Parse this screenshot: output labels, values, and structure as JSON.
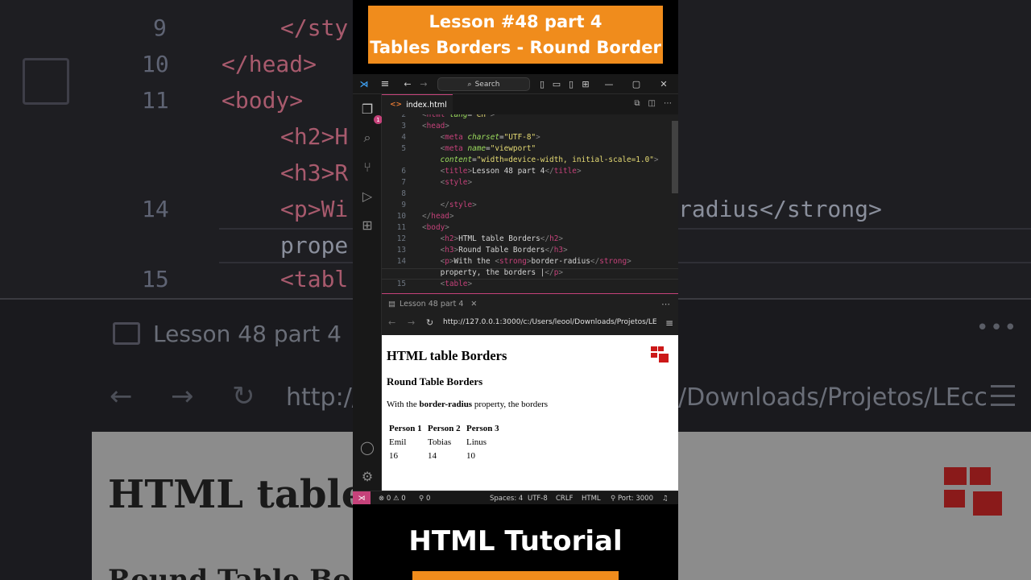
{
  "banner": {
    "line1": "Lesson #48 part 4",
    "line2": "Tables Borders - Round Border"
  },
  "footer": {
    "title": "HTML Tutorial"
  },
  "vscode": {
    "search_label": "Search",
    "explorer_badge": "1",
    "tab": {
      "filename": "index.html",
      "unsaved": true
    },
    "code_lines": [
      {
        "no": "2",
        "segments": [
          {
            "t": "br",
            "v": "<"
          },
          {
            "t": "tag",
            "v": "html"
          },
          {
            "t": "txt",
            "v": " "
          },
          {
            "t": "attr",
            "v": "lang"
          },
          {
            "t": "txt",
            "v": "="
          },
          {
            "t": "str",
            "v": "\"en\""
          },
          {
            "t": "br",
            "v": ">"
          }
        ]
      },
      {
        "no": "3",
        "segments": [
          {
            "t": "br",
            "v": "<"
          },
          {
            "t": "tag",
            "v": "head"
          },
          {
            "t": "br",
            "v": ">"
          }
        ]
      },
      {
        "no": "4",
        "segments": [
          {
            "t": "txt",
            "v": "    "
          },
          {
            "t": "br",
            "v": "<"
          },
          {
            "t": "tag",
            "v": "meta"
          },
          {
            "t": "txt",
            "v": " "
          },
          {
            "t": "attr",
            "v": "charset"
          },
          {
            "t": "txt",
            "v": "="
          },
          {
            "t": "str",
            "v": "\"UTF-8\""
          },
          {
            "t": "br",
            "v": ">"
          }
        ]
      },
      {
        "no": "5",
        "segments": [
          {
            "t": "txt",
            "v": "    "
          },
          {
            "t": "br",
            "v": "<"
          },
          {
            "t": "tag",
            "v": "meta"
          },
          {
            "t": "txt",
            "v": " "
          },
          {
            "t": "attr",
            "v": "name"
          },
          {
            "t": "txt",
            "v": "="
          },
          {
            "t": "str",
            "v": "\"viewport\""
          }
        ]
      },
      {
        "no": "",
        "segments": [
          {
            "t": "txt",
            "v": "    "
          },
          {
            "t": "attr",
            "v": "content"
          },
          {
            "t": "txt",
            "v": "="
          },
          {
            "t": "str",
            "v": "\"width=device-width, initial-scale=1.0\""
          },
          {
            "t": "br",
            "v": ">"
          }
        ]
      },
      {
        "no": "6",
        "segments": [
          {
            "t": "txt",
            "v": "    "
          },
          {
            "t": "br",
            "v": "<"
          },
          {
            "t": "tag",
            "v": "title"
          },
          {
            "t": "br",
            "v": ">"
          },
          {
            "t": "txt",
            "v": "Lesson 48 part 4"
          },
          {
            "t": "br",
            "v": "</"
          },
          {
            "t": "tag",
            "v": "title"
          },
          {
            "t": "br",
            "v": ">"
          }
        ]
      },
      {
        "no": "7",
        "segments": [
          {
            "t": "txt",
            "v": "    "
          },
          {
            "t": "br",
            "v": "<"
          },
          {
            "t": "tag",
            "v": "style"
          },
          {
            "t": "br",
            "v": ">"
          }
        ]
      },
      {
        "no": "8",
        "segments": []
      },
      {
        "no": "9",
        "segments": [
          {
            "t": "txt",
            "v": "    "
          },
          {
            "t": "br",
            "v": "</"
          },
          {
            "t": "tag",
            "v": "style"
          },
          {
            "t": "br",
            "v": ">"
          }
        ]
      },
      {
        "no": "10",
        "segments": [
          {
            "t": "br",
            "v": "</"
          },
          {
            "t": "tag",
            "v": "head"
          },
          {
            "t": "br",
            "v": ">"
          }
        ]
      },
      {
        "no": "11",
        "segments": [
          {
            "t": "br",
            "v": "<"
          },
          {
            "t": "tag",
            "v": "body"
          },
          {
            "t": "br",
            "v": ">"
          }
        ]
      },
      {
        "no": "12",
        "segments": [
          {
            "t": "txt",
            "v": "    "
          },
          {
            "t": "br",
            "v": "<"
          },
          {
            "t": "tag",
            "v": "h2"
          },
          {
            "t": "br",
            "v": ">"
          },
          {
            "t": "txt",
            "v": "HTML table Borders"
          },
          {
            "t": "br",
            "v": "</"
          },
          {
            "t": "tag",
            "v": "h2"
          },
          {
            "t": "br",
            "v": ">"
          }
        ]
      },
      {
        "no": "13",
        "segments": [
          {
            "t": "txt",
            "v": "    "
          },
          {
            "t": "br",
            "v": "<"
          },
          {
            "t": "tag",
            "v": "h3"
          },
          {
            "t": "br",
            "v": ">"
          },
          {
            "t": "txt",
            "v": "Round Table Borders"
          },
          {
            "t": "br",
            "v": "</"
          },
          {
            "t": "tag",
            "v": "h3"
          },
          {
            "t": "br",
            "v": ">"
          }
        ]
      },
      {
        "no": "14",
        "segments": [
          {
            "t": "txt",
            "v": "    "
          },
          {
            "t": "br",
            "v": "<"
          },
          {
            "t": "tag",
            "v": "p"
          },
          {
            "t": "br",
            "v": ">"
          },
          {
            "t": "txt",
            "v": "With the "
          },
          {
            "t": "br",
            "v": "<"
          },
          {
            "t": "tag",
            "v": "strong"
          },
          {
            "t": "br",
            "v": ">"
          },
          {
            "t": "txt",
            "v": "border-radius"
          },
          {
            "t": "br",
            "v": "</"
          },
          {
            "t": "tag",
            "v": "strong"
          },
          {
            "t": "br",
            "v": ">"
          }
        ]
      },
      {
        "no": "",
        "segments": [
          {
            "t": "txt",
            "v": "    property, the borders |"
          },
          {
            "t": "br",
            "v": "</"
          },
          {
            "t": "tag",
            "v": "p"
          },
          {
            "t": "br",
            "v": ">"
          }
        ]
      },
      {
        "no": "15",
        "segments": [
          {
            "t": "txt",
            "v": "    "
          },
          {
            "t": "br",
            "v": "<"
          },
          {
            "t": "tag",
            "v": "table"
          },
          {
            "t": "br",
            "v": ">"
          }
        ]
      }
    ],
    "panel": {
      "tab_title": "Lesson 48 part 4",
      "url": "http://127.0.0.1:3000/c:/Users/leool/Downloads/Projetos/LEcc"
    },
    "preview": {
      "h2": "HTML table Borders",
      "h3": "Round Table Borders",
      "p_prefix": "With the ",
      "p_strong": "border-radius",
      "p_suffix": " property, the borders",
      "table_headers": [
        "Person 1",
        "Person 2",
        "Person 3"
      ],
      "table_rows": [
        [
          "Emil",
          "Tobias",
          "Linus"
        ],
        [
          "16",
          "14",
          "10"
        ]
      ]
    },
    "status": {
      "errors": "0",
      "warnings": "0",
      "ports": "0",
      "spaces": "Spaces: 4",
      "encoding": "UTF-8",
      "eol": "CRLF",
      "language": "HTML",
      "port": "Port: 3000"
    }
  },
  "background": {
    "left_line_numbers": [
      "9",
      "10",
      "11",
      "12",
      "13",
      "14",
      "15"
    ],
    "left_code": [
      "</sty",
      "</head>",
      "<body>",
      "<h2>H",
      "<h3>R",
      "<p>Wi",
      "prope",
      "<tabl"
    ],
    "panel_title": "Lesson 48 part 4",
    "url_fragment": "http://",
    "right_code": "radius</strong>",
    "right_url": "/Downloads/Projetos/LEcc",
    "preview_heading": "HTML table",
    "preview_sub": "Round Table Bo"
  },
  "colors": {
    "accent": "#f08c1c",
    "vscode_accent": "#c5427a",
    "logo_red": "#cc1818"
  }
}
